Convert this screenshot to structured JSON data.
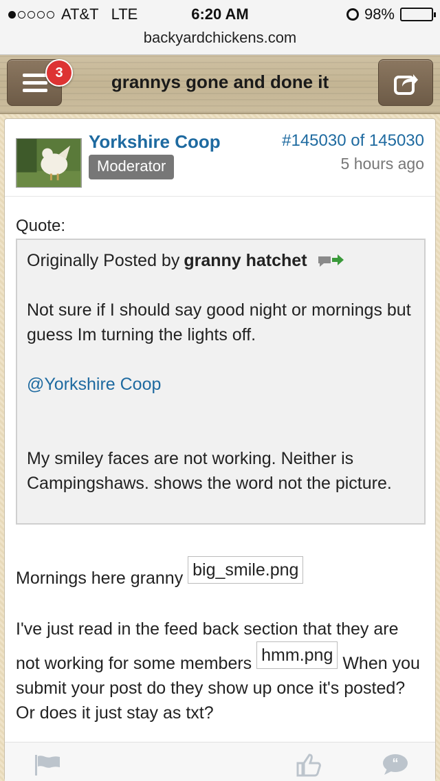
{
  "status_bar": {
    "carrier": "AT&T",
    "network": "LTE",
    "time": "6:20 AM",
    "battery": "98%",
    "signal_dots_filled": 1,
    "signal_dots_total": 5
  },
  "url_bar": {
    "domain": "backyardchickens.com"
  },
  "header": {
    "menu_badge_count": "3",
    "thread_title": "grannys gone and done it"
  },
  "post": {
    "username": "Yorkshire Coop",
    "role": "Moderator",
    "post_number": "#145030 of 145030",
    "timestamp": "5 hours ago",
    "quote_label": "Quote:",
    "quote": {
      "intro": "Originally Posted by ",
      "author": "granny hatchet",
      "paragraph_1": "Not sure if I should say good night or mornings but guess Im turning the lights off.",
      "mention": "@Yorkshire Coop",
      "paragraph_2": "My smiley faces are not working. Neither is Campingshaws. shows the word not the picture."
    },
    "body": {
      "para_1_text": "Mornings here granny",
      "para_1_image": "big_smile.png",
      "para_2_text_a": "I've just read in the feed back section that they are not working for some members",
      "para_2_image": "hmm.png",
      "para_2_text_b": "When you submit your post do they show up once it's posted? Or does it just stay as txt?"
    }
  },
  "colors": {
    "link_blue": "#1e6aa0",
    "badge_red": "#d33333",
    "moderator_gray": "#777777",
    "wood": "#c4b594"
  },
  "icons": [
    "hamburger-icon",
    "share-icon",
    "alarm-icon",
    "battery-icon",
    "quote-link-icon",
    "flag-icon",
    "like-icon",
    "quote-reply-icon"
  ]
}
